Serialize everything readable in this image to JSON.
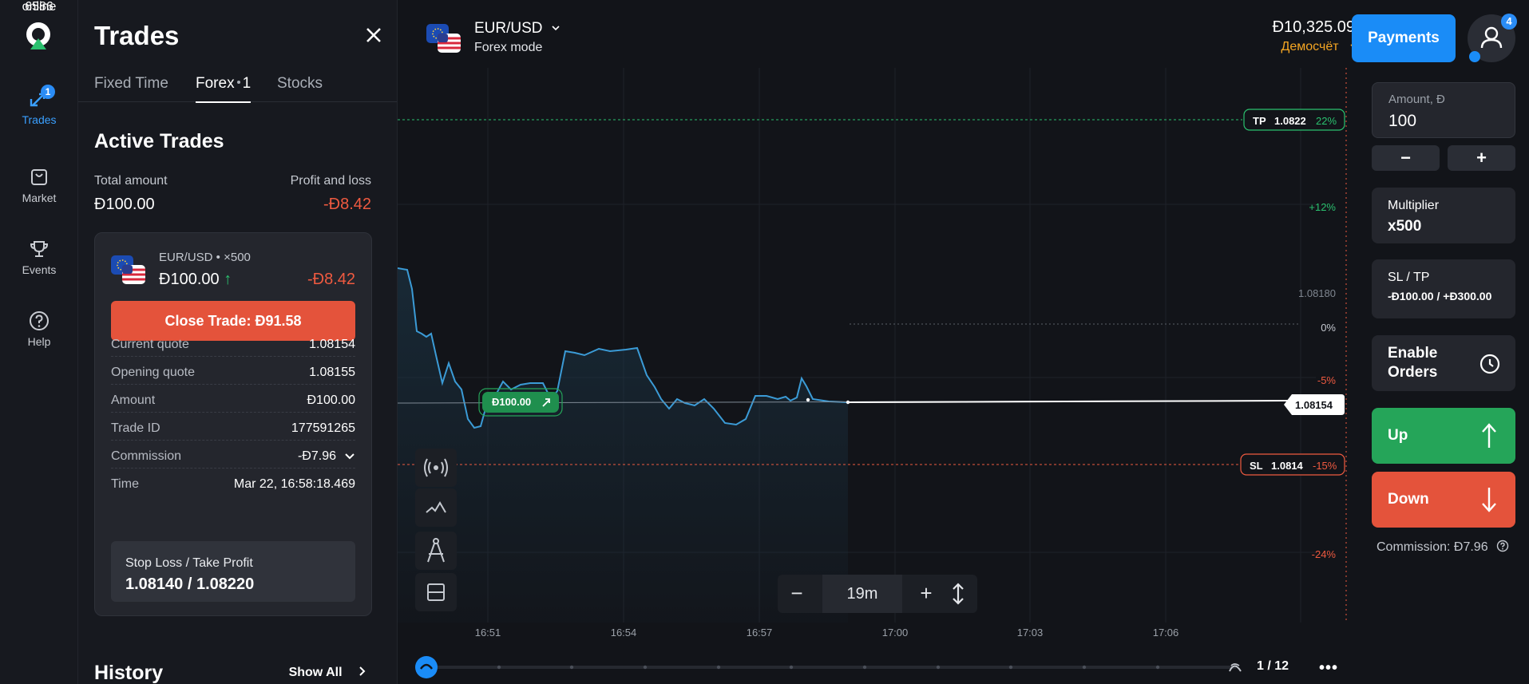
{
  "rail": {
    "items": [
      {
        "label": "Trades",
        "badge": "1"
      },
      {
        "label": "Market"
      },
      {
        "label": "Events"
      },
      {
        "label": "Help"
      }
    ],
    "online_count": "6586",
    "online_label": "online"
  },
  "panel": {
    "title": "Trades",
    "tabs": [
      {
        "label": "Fixed Time"
      },
      {
        "label": "Forex",
        "count": "1"
      },
      {
        "label": "Stocks"
      }
    ],
    "section_title": "Active Trades",
    "total_amount_label": "Total amount",
    "total_amount": "Đ100.00",
    "pl_label": "Profit and loss",
    "pl_value": "-Đ8.42",
    "trade": {
      "pair": "EUR/USD",
      "multiplier": "×500",
      "amount": "Đ100.00",
      "direction_arrow": "↑",
      "pl": "-Đ8.42",
      "close_label": "Close Trade: Đ91.58",
      "rows": [
        {
          "k": "Current quote",
          "v": "1.08154"
        },
        {
          "k": "Opening quote",
          "v": "1.08155"
        },
        {
          "k": "Amount",
          "v": "Đ100.00"
        },
        {
          "k": "Trade ID",
          "v": "177591265"
        },
        {
          "k": "Commission",
          "v": "-Đ7.96"
        },
        {
          "k": "Time",
          "v": "Mar 22, 16:58:18.469"
        }
      ],
      "sltp_label": "Stop Loss / Take Profit",
      "sltp_value": "1.08140 / 1.08220"
    },
    "history_label": "History",
    "show_all_label": "Show All"
  },
  "header": {
    "pair": "EUR/USD",
    "mode": "Forex mode",
    "balance": "Đ10,325.09",
    "account": "Демосчёт",
    "payments_label": "Payments",
    "avatar_badge": "4"
  },
  "chart": {
    "tp_label": "TP",
    "tp_price": "1.0822",
    "tp_pct": "22%",
    "sl_label": "SL",
    "sl_price": "1.0814",
    "sl_pct": "-15%",
    "current_price": "1.08154",
    "price_tick": "1.08180",
    "pct_levels": [
      "+12%",
      "0%",
      "-5%",
      "-24%"
    ],
    "trade_marker": "Đ100.00",
    "time_labels": [
      "16:51",
      "16:54",
      "16:57",
      "17:00",
      "17:03",
      "17:06"
    ],
    "zoom_value": "19m",
    "page_indicator": "1 / 12",
    "colors": {
      "line": "#3b9bd6",
      "up": "#25a559",
      "down": "#e4533b",
      "tp": "#2bc16f",
      "sl": "#ef5a40"
    }
  },
  "order": {
    "amount_label": "Amount, Đ",
    "amount_value": "100",
    "minus": "−",
    "plus": "+",
    "multiplier_label": "Multiplier",
    "multiplier_value": "x500",
    "sltp_label": "SL / TP",
    "sltp_value": "-Đ100.00 / +Đ300.00",
    "orders_label": "Enable Orders",
    "up_label": "Up",
    "down_label": "Down",
    "commission": "Commission: Đ7.96"
  }
}
